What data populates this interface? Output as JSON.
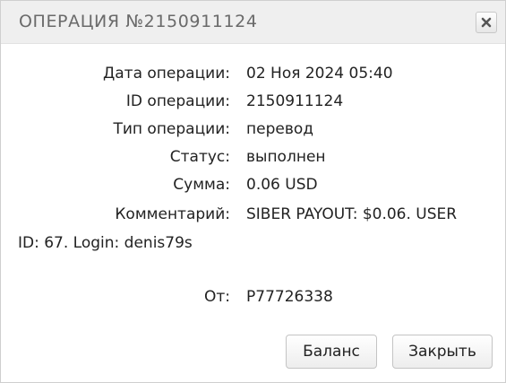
{
  "dialog": {
    "title": "ОПЕРАЦИЯ №2150911124",
    "close_icon": "close-icon"
  },
  "details": {
    "date": {
      "label": "Дата операции:",
      "value": "02 Ноя 2024 05:40"
    },
    "id": {
      "label": "ID операции:",
      "value": "2150911124"
    },
    "type": {
      "label": "Тип операции:",
      "value": "перевод"
    },
    "status": {
      "label": "Статус:",
      "value": "выполнен"
    },
    "amount": {
      "label": "Сумма:",
      "value": "0.06 USD"
    },
    "comment": {
      "label": "Комментарий:",
      "value": "SIBER PAYOUT: $0.06. USER",
      "continuation": "ID: 67. Login: denis79s"
    },
    "from": {
      "label": "От:",
      "value": "P77726338"
    }
  },
  "buttons": {
    "balance_label": "Баланс",
    "close_label": "Закрыть"
  }
}
